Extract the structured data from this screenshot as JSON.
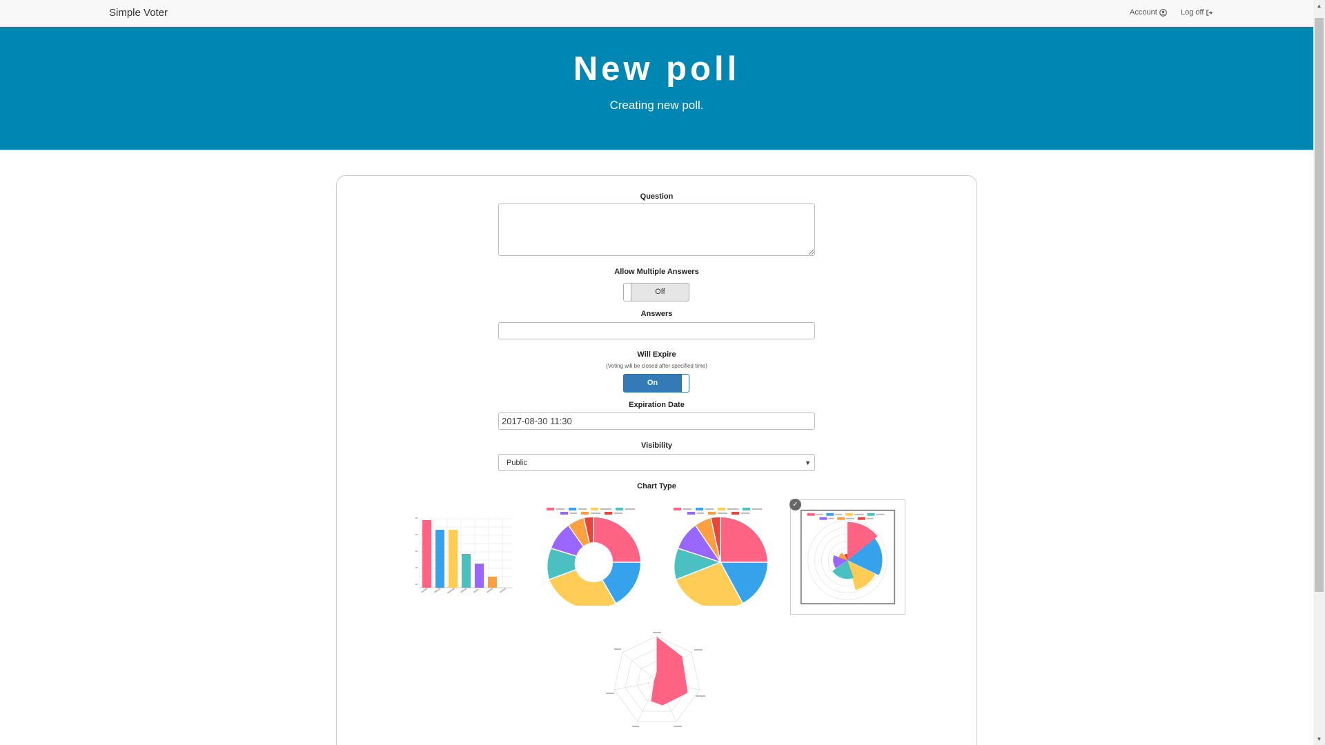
{
  "navbar": {
    "brand": "Simple Voter",
    "account": "Account",
    "logoff": "Log off"
  },
  "hero": {
    "title": "New poll",
    "subtitle": "Creating new poll."
  },
  "form": {
    "question_label": "Question",
    "question_value": "",
    "multiple_label": "Allow Multiple Answers",
    "multiple_toggle": "Off",
    "answers_label": "Answers",
    "answers_value": "",
    "expire_label": "Will Expire",
    "expire_hint": "(Voting will be closed after specified time)",
    "expire_toggle": "On",
    "expiration_label": "Expiration Date",
    "expiration_value": "2017-08-30 11:30",
    "visibility_label": "Visibility",
    "visibility_value": "Public",
    "chart_type_label": "Chart Type"
  },
  "chart_types": [
    {
      "name": "bar",
      "selected": false
    },
    {
      "name": "doughnut",
      "selected": false
    },
    {
      "name": "pie",
      "selected": false
    },
    {
      "name": "polar-area",
      "selected": true
    },
    {
      "name": "radar",
      "selected": false
    }
  ],
  "colors": {
    "navbar_bg": "#f8f8f8",
    "hero_bg": "#0086b3",
    "toggle_on": "#337ab7",
    "palette": [
      "#ff6384",
      "#36a2eb",
      "#ffcd56",
      "#4bc0c0",
      "#9966ff",
      "#ff9f40",
      "#e8443a"
    ]
  }
}
